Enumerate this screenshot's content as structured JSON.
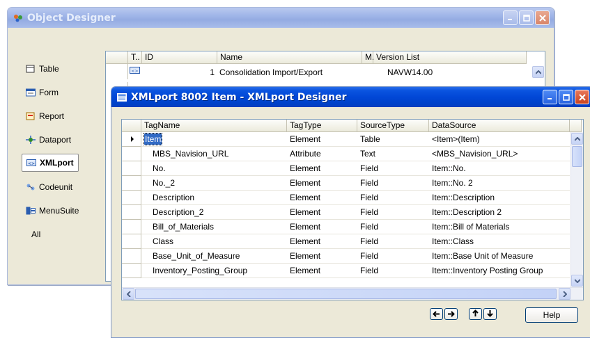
{
  "object_designer": {
    "title": "Object Designer",
    "nav": [
      {
        "label": "Table",
        "icon": "table-icon"
      },
      {
        "label": "Form",
        "icon": "form-icon"
      },
      {
        "label": "Report",
        "icon": "report-icon"
      },
      {
        "label": "Dataport",
        "icon": "dataport-icon"
      },
      {
        "label": "XMLport",
        "icon": "xmlport-icon",
        "selected": true
      },
      {
        "label": "Codeunit",
        "icon": "codeunit-icon"
      },
      {
        "label": "MenuSuite",
        "icon": "menusuite-icon"
      },
      {
        "label": "All",
        "icon": ""
      }
    ],
    "columns": {
      "type": "T..",
      "id": "ID",
      "name": "Name",
      "modified": "M.",
      "version": "Version List"
    },
    "rows": [
      {
        "id": "1",
        "name": "Consolidation Import/Export",
        "version": "NAVW14.00"
      }
    ]
  },
  "xmlport_designer": {
    "title": "XMLport 8002 Item - XMLport Designer",
    "columns": {
      "tag_name": "TagName",
      "tag_type": "TagType",
      "source_type": "SourceType",
      "data_source": "DataSource"
    },
    "rows": [
      {
        "tag_name": "Item",
        "tag_type": "Element",
        "source_type": "Table",
        "data_source": "<Item>(Item)"
      },
      {
        "tag_name": "MBS_Navision_URL",
        "tag_type": "Attribute",
        "source_type": "Text",
        "data_source": "<MBS_Navision_URL>"
      },
      {
        "tag_name": "No.",
        "tag_type": "Element",
        "source_type": "Field",
        "data_source": "Item::No."
      },
      {
        "tag_name": "No._2",
        "tag_type": "Element",
        "source_type": "Field",
        "data_source": "Item::No. 2"
      },
      {
        "tag_name": "Description",
        "tag_type": "Element",
        "source_type": "Field",
        "data_source": "Item::Description"
      },
      {
        "tag_name": "Description_2",
        "tag_type": "Element",
        "source_type": "Field",
        "data_source": "Item::Description 2"
      },
      {
        "tag_name": "Bill_of_Materials",
        "tag_type": "Element",
        "source_type": "Field",
        "data_source": "Item::Bill of Materials"
      },
      {
        "tag_name": "Class",
        "tag_type": "Element",
        "source_type": "Field",
        "data_source": "Item::Class"
      },
      {
        "tag_name": "Base_Unit_of_Measure",
        "tag_type": "Element",
        "source_type": "Field",
        "data_source": "Item::Base Unit of Measure"
      },
      {
        "tag_name": "Inventory_Posting_Group",
        "tag_type": "Element",
        "source_type": "Field",
        "data_source": "Item::Inventory Posting Group"
      }
    ],
    "buttons": {
      "help": "Help"
    }
  },
  "colors": {
    "title_active": "#0a54e0",
    "title_inactive": "#9db3e7",
    "window_face": "#ece9d8",
    "selection": "#316ac5"
  }
}
